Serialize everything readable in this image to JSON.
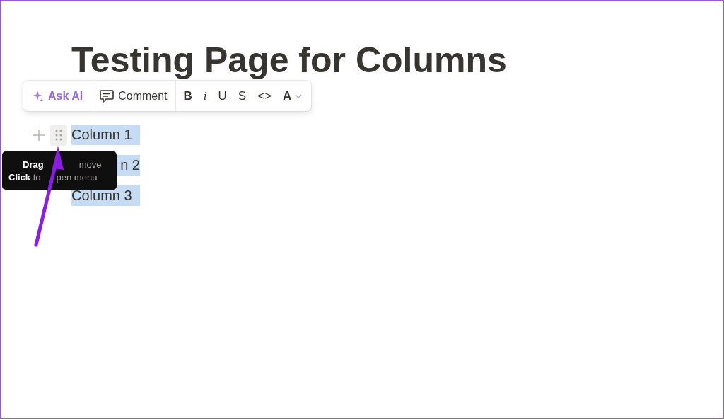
{
  "title": "Testing Page for Columns",
  "toolbar": {
    "ask_ai": "Ask AI",
    "comment": "Comment",
    "format_buttons": [
      {
        "kind": "bold",
        "label": "B"
      },
      {
        "kind": "italic",
        "label": "i"
      },
      {
        "kind": "underline",
        "label": "U"
      },
      {
        "kind": "strike",
        "label": "S"
      },
      {
        "kind": "code",
        "label": "<>"
      },
      {
        "kind": "color",
        "label": "A"
      }
    ]
  },
  "blocks": [
    {
      "text": "Column 1",
      "selected": true
    },
    {
      "text": "n 2",
      "selected": true
    },
    {
      "text": "Column 3",
      "selected": true
    }
  ],
  "tooltip": {
    "lines": [
      [
        "**Drag**",
        "move"
      ],
      [
        "**Click** to",
        "pen menu"
      ]
    ]
  }
}
